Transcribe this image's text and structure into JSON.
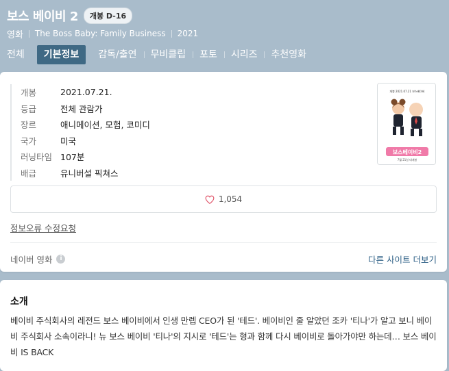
{
  "header": {
    "title": "보스 베이비 2",
    "badge": "개봉 D-16",
    "kind": "영화",
    "original_title": "The Boss Baby: Family Business",
    "year": "2021"
  },
  "tabs": [
    {
      "label": "전체",
      "active": false
    },
    {
      "label": "기본정보",
      "active": true
    },
    {
      "label": "감독/출연",
      "active": false
    },
    {
      "label": "무비클립",
      "active": false
    },
    {
      "label": "포토",
      "active": false
    },
    {
      "label": "시리즈",
      "active": false
    },
    {
      "label": "추천영화",
      "active": false
    }
  ],
  "info": {
    "rows": [
      {
        "key": "개봉",
        "value": "2021.07.21."
      },
      {
        "key": "등급",
        "value": "전체 관람가"
      },
      {
        "key": "장르",
        "value": "애니메이션, 모험, 코미디"
      },
      {
        "key": "국가",
        "value": "미국"
      },
      {
        "key": "러닝타임",
        "value": "107분"
      },
      {
        "key": "배급",
        "value": "유니버설 픽쳐스"
      }
    ]
  },
  "poster": {
    "top_text": "개봉 2021.07.21 보스베이비",
    "logo_text": "보스베이비2",
    "date_text": "7월 21일 대개봉",
    "colors": {
      "bg": "#ffffff",
      "logo": "#f07aa8",
      "suit": "#1f2430",
      "hair": "#7a4a2a"
    }
  },
  "like": {
    "count": "1,054"
  },
  "links": {
    "report": "정보오류 수정요청",
    "source": "네이버 영화",
    "more": "다른 사이트 더보기"
  },
  "synopsis": {
    "title": "소개",
    "text": "베이비 주식회사의 레전드 보스 베이비에서 인생 만렙 CEO가 된 '테드'. 베이비인 줄 알았던 조카 '티나'가 알고 보니 베이비 주식회사 소속이라니! 뉴 보스 베이비 '티나'의 지시로 '테드'는 형과 함께 다시 베이비로 돌아가야만 하는데… 보스 베이비 IS BACK"
  }
}
